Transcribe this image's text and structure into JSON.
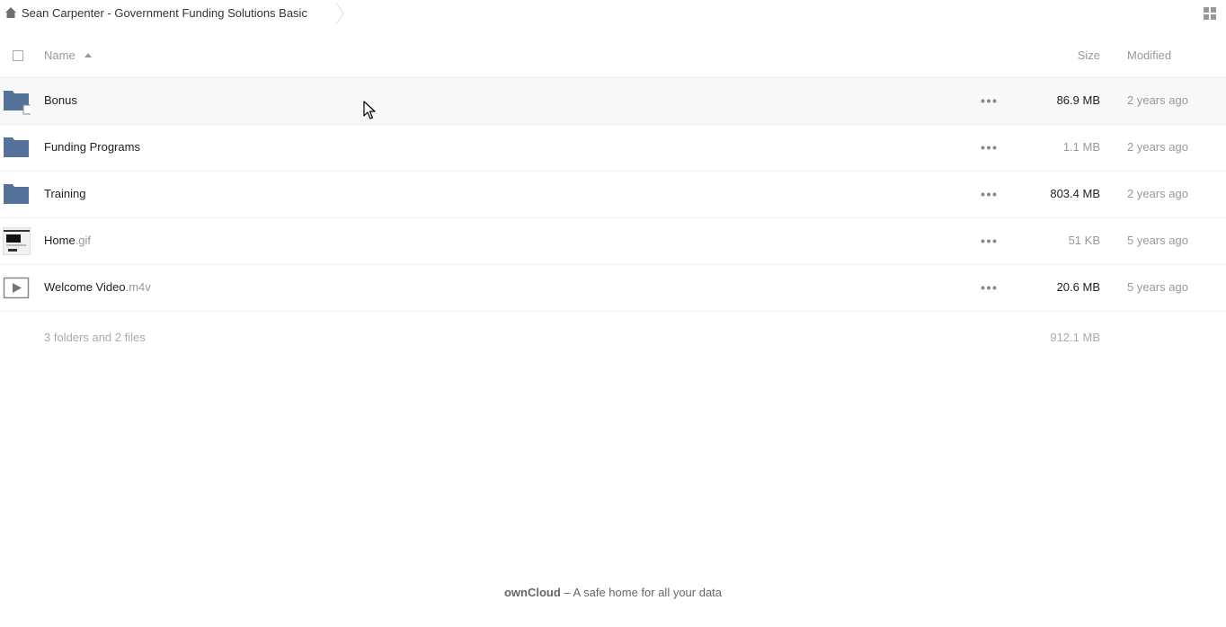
{
  "breadcrumb": {
    "folder": "Sean Carpenter - Government Funding Solutions Basic"
  },
  "header": {
    "name_label": "Name",
    "size_label": "Size",
    "modified_label": "Modified"
  },
  "files": [
    {
      "name": "Bonus",
      "ext": "",
      "type": "folder-shared",
      "size": "86.9 MB",
      "size_color": "#222222",
      "modified": "2 years ago"
    },
    {
      "name": "Funding Programs",
      "ext": "",
      "type": "folder",
      "size": "1.1 MB",
      "size_color": "#999999",
      "modified": "2 years ago"
    },
    {
      "name": "Training",
      "ext": "",
      "type": "folder",
      "size": "803.4 MB",
      "size_color": "#222222",
      "modified": "2 years ago"
    },
    {
      "name": "Home",
      "ext": ".gif",
      "type": "image-thumbnail",
      "size": "51 KB",
      "size_color": "#999999",
      "modified": "5 years ago"
    },
    {
      "name": "Welcome Video",
      "ext": ".m4v",
      "type": "video",
      "size": "20.6 MB",
      "size_color": "#222222",
      "modified": "5 years ago"
    }
  ],
  "summary": {
    "count": "3 folders and 2 files",
    "total_size": "912.1 MB"
  },
  "footer": {
    "brand": "ownCloud",
    "tagline": " – A safe home for all your data"
  },
  "colors": {
    "folder": "#55729a",
    "muted": "#999999",
    "hover_row": "#f8f8f8"
  }
}
